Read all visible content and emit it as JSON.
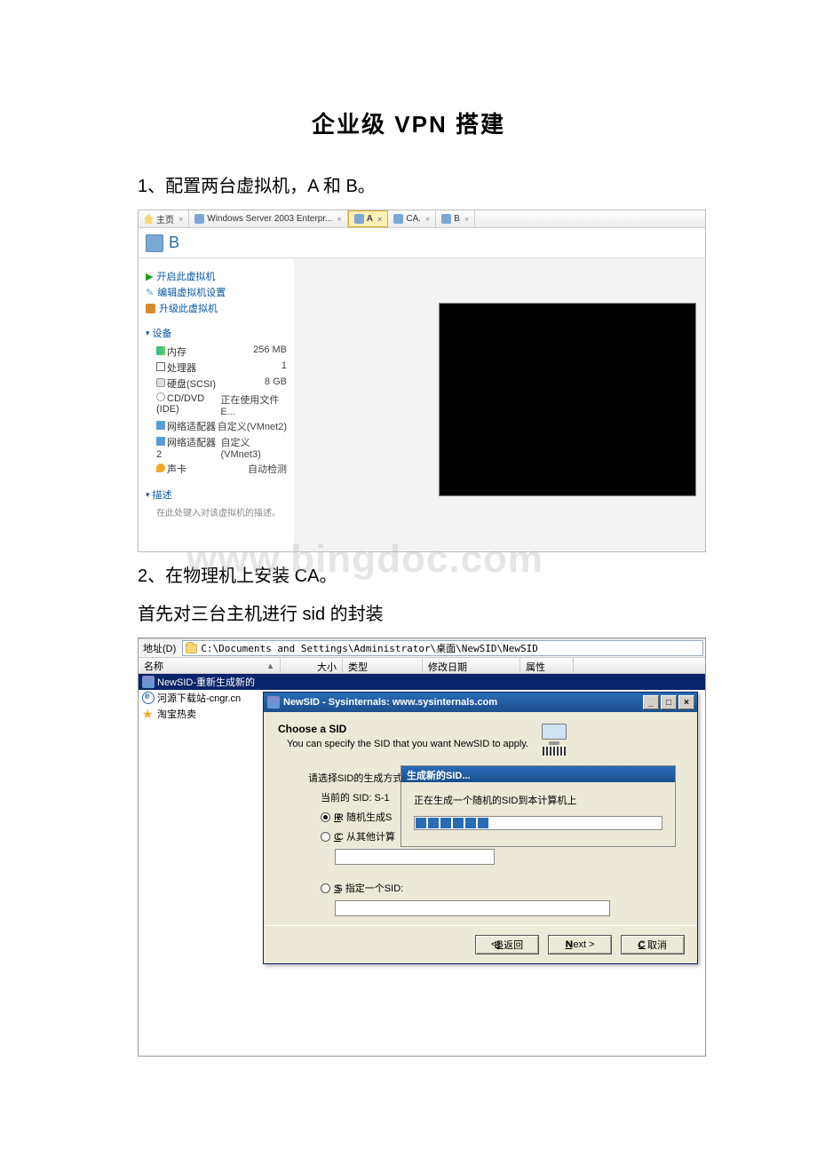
{
  "title": "企业级 VPN 搭建",
  "step1": "1、配置两台虚拟机，A 和 B。",
  "step2": "2、在物理机上安装 CA。",
  "subtext": "首先对三台主机进行 sid 的封装",
  "watermark": "www.bingdoc.com",
  "vm": {
    "tabs": [
      {
        "label": "主页",
        "icon": "home"
      },
      {
        "label": "Windows Server 2003 Enterpr...",
        "icon": "vm"
      },
      {
        "label": "A",
        "icon": "vm",
        "selected": true
      },
      {
        "label": "CA.",
        "icon": "vm"
      },
      {
        "label": "B",
        "icon": "vm"
      }
    ],
    "vmname": "B",
    "actions": {
      "power": "开启此虚拟机",
      "edit": "编辑虚拟机设置",
      "upgrade": "升级此虚拟机"
    },
    "sections": {
      "devices": "设备",
      "description": "描述"
    },
    "devices": [
      {
        "name": "内存",
        "value": "256 MB",
        "ico": "mem"
      },
      {
        "name": "处理器",
        "value": "1",
        "ico": "cpu"
      },
      {
        "name": "硬盘(SCSI)",
        "value": "8 GB",
        "ico": "disk"
      },
      {
        "name": "CD/DVD (IDE)",
        "value": "正在使用文件 E...",
        "ico": "cd"
      },
      {
        "name": "网络适配器",
        "value": "自定义(VMnet2)",
        "ico": "net"
      },
      {
        "name": "网络适配器 2",
        "value": "自定义(VMnet3)",
        "ico": "net"
      },
      {
        "name": "声卡",
        "value": "自动检测",
        "ico": "snd"
      }
    ],
    "desc_placeholder": "在此处键入对该虚拟机的描述。"
  },
  "explorer": {
    "address_label": "地址(D)",
    "address_path": "C:\\Documents and Settings\\Administrator\\桌面\\NewSID\\NewSID",
    "columns": {
      "name": "名称",
      "size": "大小",
      "type": "类型",
      "date": "修改日期",
      "attr": "属性"
    },
    "files": [
      {
        "name": "NewSID-重新生成新的",
        "selected": true,
        "ico": "app"
      },
      {
        "name": "河源下载站-cngr.cn",
        "ico": "ie"
      },
      {
        "name": "淘宝热卖",
        "ico": "star"
      }
    ]
  },
  "dialog": {
    "title": "NewSID - Sysinternals: www.sysinternals.com",
    "heading": "Choose a SID",
    "subheading": "You can specify the SID that you want NewSID to apply.",
    "opts_label": "请选择SID的生成方式:",
    "current_sid": "当前的 SID: S-1",
    "radio_random": "R 随机生成S",
    "radio_other": "C 从其他计算",
    "radio_specify": "S 指定一个SID:",
    "buttons": {
      "back": "B 返回",
      "next": "Next >",
      "cancel": "C 取消"
    }
  },
  "progress": {
    "title": "生成新的SID...",
    "msg": "正在生成一个随机的SID到本计算机上"
  }
}
